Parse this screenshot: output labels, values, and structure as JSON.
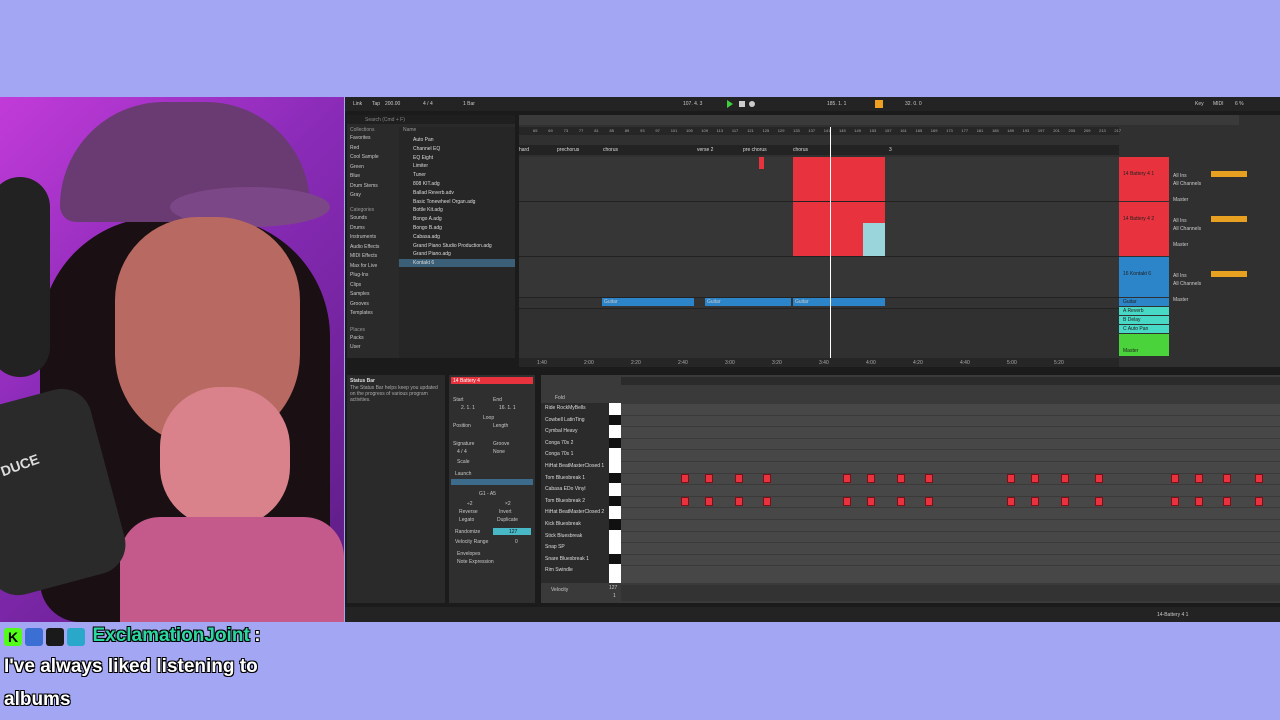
{
  "daw": {
    "transport": {
      "tempo": "200.00",
      "time_sig": "4 / 4",
      "quantize": "1 Bar",
      "position": "107. 4. 3",
      "loop_start": "185. 1. 1",
      "loop_length": "32. 0. 0",
      "key_label": "Key",
      "midi_label": "MIDI",
      "cpu": "6 %"
    },
    "browser": {
      "search_placeholder": "Search (Cmd + F)",
      "collections_header": "Collections",
      "collections": [
        "Favorites",
        "Red",
        "Cool Sample",
        "Green",
        "Blue",
        "Drum Stems",
        "Gray"
      ],
      "categories_header": "Categories",
      "categories": [
        "Sounds",
        "Drums",
        "Instruments",
        "Audio Effects",
        "MIDI Effects",
        "Max for Live",
        "Plug-Ins",
        "Clips",
        "Samples",
        "Grooves",
        "Templates"
      ],
      "places_header": "Places",
      "places": [
        "Packs",
        "User"
      ],
      "name_header": "Name",
      "files": [
        "Auto Pan",
        "Channel EQ",
        "EQ Eight",
        "Limiter",
        "Tuner",
        "808 KIT.adg",
        "Ballad Reverb.adv",
        "Basic Tonewheel Organ.adg",
        "Bottle Kit.adg",
        "Bongo A.adg",
        "Bongo B.adg",
        "Cabasa.adg",
        "Grand Piano Studio Production.adg",
        "Grand Piano.adg",
        "Kontakt 6"
      ]
    },
    "arrangement": {
      "locators": [
        "hard",
        "prechorus",
        "chorus",
        "verse 2",
        "pre chorus",
        "chorus",
        "3"
      ],
      "ruler": [
        "65",
        "69",
        "73",
        "77",
        "81",
        "85",
        "89",
        "93",
        "97",
        "101",
        "105",
        "109",
        "113",
        "117",
        "121",
        "125",
        "129",
        "133",
        "137",
        "141",
        "145",
        "149",
        "153",
        "157",
        "161",
        "165",
        "169",
        "173",
        "177",
        "181",
        "185",
        "189",
        "193",
        "197",
        "201",
        "205",
        "209",
        "213",
        "217"
      ],
      "time_ruler": [
        "1:40",
        "2:00",
        "2:20",
        "2:40",
        "3:00",
        "3:20",
        "3:40",
        "4:00",
        "4:20",
        "4:40",
        "5:00",
        "5:20"
      ],
      "tracks": [
        {
          "name": "14 Battery 4 1",
          "color": "#e8323d",
          "in": "All Ins",
          "ch": "All Channels",
          "out": "Master"
        },
        {
          "name": "14 Battery 4 2",
          "color": "#e8323d",
          "in": "All Ins",
          "ch": "All Channels",
          "out": "Master"
        },
        {
          "name": "16 Kontakt 6",
          "color": "#2c85c9",
          "in": "All Ins",
          "ch": "All Channels",
          "out": "Master"
        },
        {
          "name": "Guitar",
          "color": "#2c85c9"
        },
        {
          "name": "A Reverb",
          "color": "#48d8c6"
        },
        {
          "name": "B Delay",
          "color": "#48d8c6"
        },
        {
          "name": "C Auto Pan",
          "color": "#48d8c6"
        },
        {
          "name": "Master",
          "color": "#4ad33a"
        }
      ],
      "clip_label": "Guitar"
    },
    "info": {
      "title": "Status Bar",
      "body": "The Status Bar helps keep you updated on the progress of various program activities."
    },
    "clip": {
      "name": "14 Battery 4",
      "start_label": "Start",
      "end_label": "End",
      "start_val": "2. 1. 1",
      "end_val": "16. 1. 1",
      "loop_label": "Loop",
      "position_label": "Position",
      "length_label": "Length",
      "signature_label": "Signature",
      "groove_label": "Groove",
      "sig_val": "4 / 4",
      "groove_val": "None",
      "scale_label": "Scale",
      "launch_label": "Launch",
      "range_val": "G1 - A5",
      "btn_div2": "÷2",
      "btn_x2": "×2",
      "btn_reverse": "Reverse",
      "btn_invert": "Invert",
      "btn_legato": "Legato",
      "btn_duplicate": "Duplicate",
      "randomize_label": "Randomize",
      "randomize_val": "127",
      "velocity_range_label": "Velocity Range",
      "velocity_range_val": "0",
      "envelopes": "Envelopes",
      "note_expression": "Note Expression"
    },
    "piano_roll": {
      "fold_label": "Fold",
      "lanes": [
        "Ride RockMyBells",
        "Cowbell LatinTing",
        "Cymbal Heavy",
        "Conga 70s 2",
        "Conga 70s 1",
        "HiHat BeatMasterClosed 1",
        "Tom Bluesbreak 1",
        "Cabasa EDo Vinyl",
        "Tom Bluesbreak 2",
        "HiHat BeatMasterClosed 2",
        "Kick Bluesbreak",
        "Stick Bluesbreak",
        "Snap SP",
        "Snare Bluesbreak 1",
        "Rim Swindle"
      ],
      "velocity_label": "Velocity",
      "velocity_max": "127",
      "velocity_min": "1"
    },
    "status": {
      "track_name": "14-Battery 4 1"
    }
  },
  "chat": {
    "username": "ExclamationJoint",
    "colon": ":",
    "message_line1": "I've always liked listening to",
    "message_line2": "albums",
    "badges": [
      {
        "letter": "K",
        "color": "#53fc18"
      },
      {
        "letter": "",
        "color": "#3b6fd4"
      },
      {
        "letter": "",
        "color": "#1a1a1a"
      },
      {
        "letter": "",
        "color": "#2aa8c9"
      }
    ]
  },
  "webcam": {
    "mic_text": "DUCE"
  }
}
